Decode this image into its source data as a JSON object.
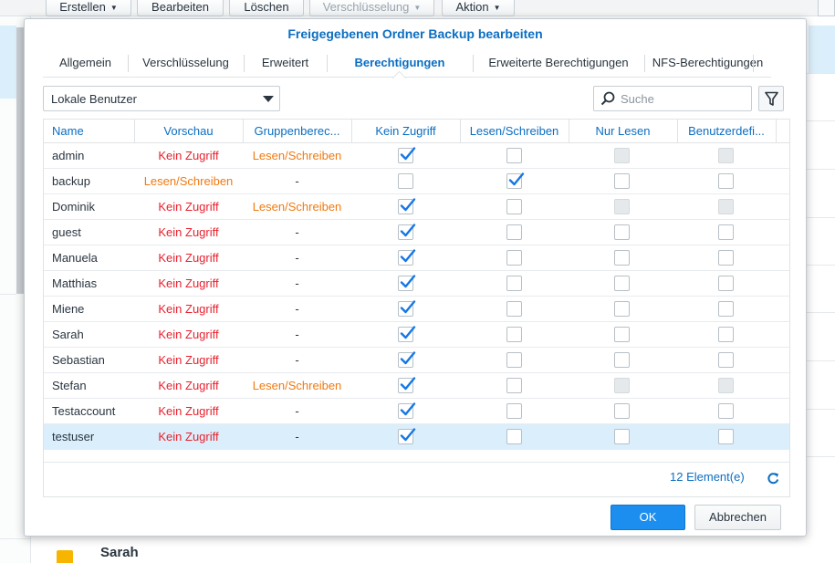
{
  "toolbar": {
    "buttons": [
      {
        "label": "Erstellen",
        "caret": true,
        "enabled": true
      },
      {
        "label": "Bearbeiten",
        "caret": false,
        "enabled": true
      },
      {
        "label": "Löschen",
        "caret": false,
        "enabled": true
      },
      {
        "label": "Verschlüsselung",
        "caret": true,
        "enabled": false
      },
      {
        "label": "Aktion",
        "caret": true,
        "enabled": true
      }
    ]
  },
  "background": {
    "partial_item": "Sarah"
  },
  "dialog": {
    "title": "Freigegebenen Ordner Backup bearbeiten",
    "tabs": [
      {
        "label": "Allgemein",
        "active": false
      },
      {
        "label": "Verschlüsselung",
        "active": false
      },
      {
        "label": "Erweitert",
        "active": false
      },
      {
        "label": "Berechtigungen",
        "active": true
      },
      {
        "label": "Erweiterte Berechtigungen",
        "active": false
      },
      {
        "label": "NFS-Berechtigungen",
        "active": false
      }
    ],
    "user_type_select": "Lokale Benutzer",
    "search_placeholder": "Suche",
    "columns": [
      "Name",
      "Vorschau",
      "Gruppenberec...",
      "Kein Zugriff",
      "Lesen/Schreiben",
      "Nur Lesen",
      "Benutzerdefi..."
    ],
    "rows": [
      {
        "name": "admin",
        "preview": "Kein Zugriff",
        "group": "Lesen/Schreiben",
        "no_access": true,
        "read_write": false,
        "read_only": false,
        "custom": false,
        "ro_disabled": true,
        "custom_disabled": true,
        "selected": false
      },
      {
        "name": "backup",
        "preview": "Lesen/Schreiben",
        "group": "-",
        "no_access": false,
        "read_write": true,
        "read_only": false,
        "custom": false,
        "ro_disabled": false,
        "custom_disabled": false,
        "selected": false
      },
      {
        "name": "Dominik",
        "preview": "Kein Zugriff",
        "group": "Lesen/Schreiben",
        "no_access": true,
        "read_write": false,
        "read_only": false,
        "custom": false,
        "ro_disabled": true,
        "custom_disabled": true,
        "selected": false
      },
      {
        "name": "guest",
        "preview": "Kein Zugriff",
        "group": "-",
        "no_access": true,
        "read_write": false,
        "read_only": false,
        "custom": false,
        "ro_disabled": false,
        "custom_disabled": false,
        "selected": false
      },
      {
        "name": "Manuela",
        "preview": "Kein Zugriff",
        "group": "-",
        "no_access": true,
        "read_write": false,
        "read_only": false,
        "custom": false,
        "ro_disabled": false,
        "custom_disabled": false,
        "selected": false
      },
      {
        "name": "Matthias",
        "preview": "Kein Zugriff",
        "group": "-",
        "no_access": true,
        "read_write": false,
        "read_only": false,
        "custom": false,
        "ro_disabled": false,
        "custom_disabled": false,
        "selected": false
      },
      {
        "name": "Miene",
        "preview": "Kein Zugriff",
        "group": "-",
        "no_access": true,
        "read_write": false,
        "read_only": false,
        "custom": false,
        "ro_disabled": false,
        "custom_disabled": false,
        "selected": false
      },
      {
        "name": "Sarah",
        "preview": "Kein Zugriff",
        "group": "-",
        "no_access": true,
        "read_write": false,
        "read_only": false,
        "custom": false,
        "ro_disabled": false,
        "custom_disabled": false,
        "selected": false
      },
      {
        "name": "Sebastian",
        "preview": "Kein Zugriff",
        "group": "-",
        "no_access": true,
        "read_write": false,
        "read_only": false,
        "custom": false,
        "ro_disabled": false,
        "custom_disabled": false,
        "selected": false
      },
      {
        "name": "Stefan",
        "preview": "Kein Zugriff",
        "group": "Lesen/Schreiben",
        "no_access": true,
        "read_write": false,
        "read_only": false,
        "custom": false,
        "ro_disabled": true,
        "custom_disabled": true,
        "selected": false
      },
      {
        "name": "Testaccount",
        "preview": "Kein Zugriff",
        "group": "-",
        "no_access": true,
        "read_write": false,
        "read_only": false,
        "custom": false,
        "ro_disabled": false,
        "custom_disabled": false,
        "selected": false
      },
      {
        "name": "testuser",
        "preview": "Kein Zugriff",
        "group": "-",
        "no_access": true,
        "read_write": false,
        "read_only": false,
        "custom": false,
        "ro_disabled": false,
        "custom_disabled": false,
        "selected": true
      }
    ],
    "item_count": "12 Element(e)",
    "ok_label": "OK",
    "cancel_label": "Abbrechen"
  },
  "colors": {
    "accent": "#0b6ec2",
    "no_access_red": "#e8212e",
    "read_write_orange": "#f07a12",
    "check_blue": "#1577e6",
    "primary_button": "#1c8ef0",
    "selected_row": "#dbeefb"
  },
  "icons": {
    "search": "search-icon",
    "filter": "filter-icon",
    "refresh": "refresh-icon",
    "checkmark": "checkmark-icon",
    "dropdown": "chevron-down-icon"
  }
}
